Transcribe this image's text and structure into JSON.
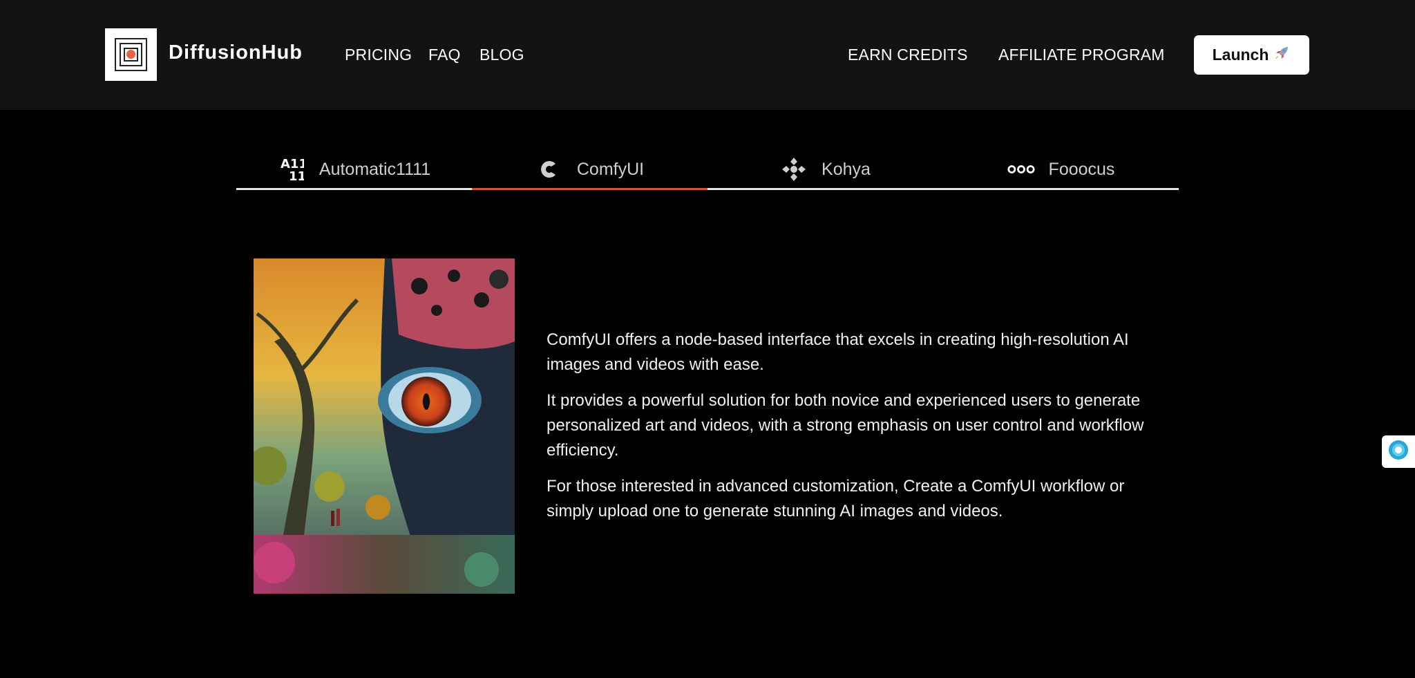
{
  "header": {
    "brand": "DiffusionHub",
    "nav_left": [
      "PRICING",
      "FAQ",
      "BLOG"
    ],
    "nav_right": [
      "EARN CREDITS",
      "AFFILIATE PROGRAM"
    ],
    "launch_label": "Launch",
    "launch_icon": "rocket-icon"
  },
  "tabs": [
    {
      "label": "Automatic1111",
      "icon": "a1111-icon",
      "active": false
    },
    {
      "label": "ComfyUI",
      "icon": "comfyui-icon",
      "active": true
    },
    {
      "label": "Kohya",
      "icon": "kohya-icon",
      "active": false
    },
    {
      "label": "Fooocus",
      "icon": "fooocus-icon",
      "active": false
    }
  ],
  "content": {
    "paragraphs": [
      "ComfyUI offers a node-based interface that excels in creating high-resolution AI images and videos with ease.",
      "It provides a powerful solution for both novice and experienced users to generate personalized art and videos, with a strong emphasis on user control and workflow efficiency.",
      "For those interested in advanced customization, Create a ComfyUI workflow or simply upload one to generate stunning AI images and videos."
    ]
  },
  "colors": {
    "header_bg": "#131313",
    "page_bg": "#000000",
    "active_tab": "#c9553a",
    "logo_dot": "#e8624a"
  }
}
